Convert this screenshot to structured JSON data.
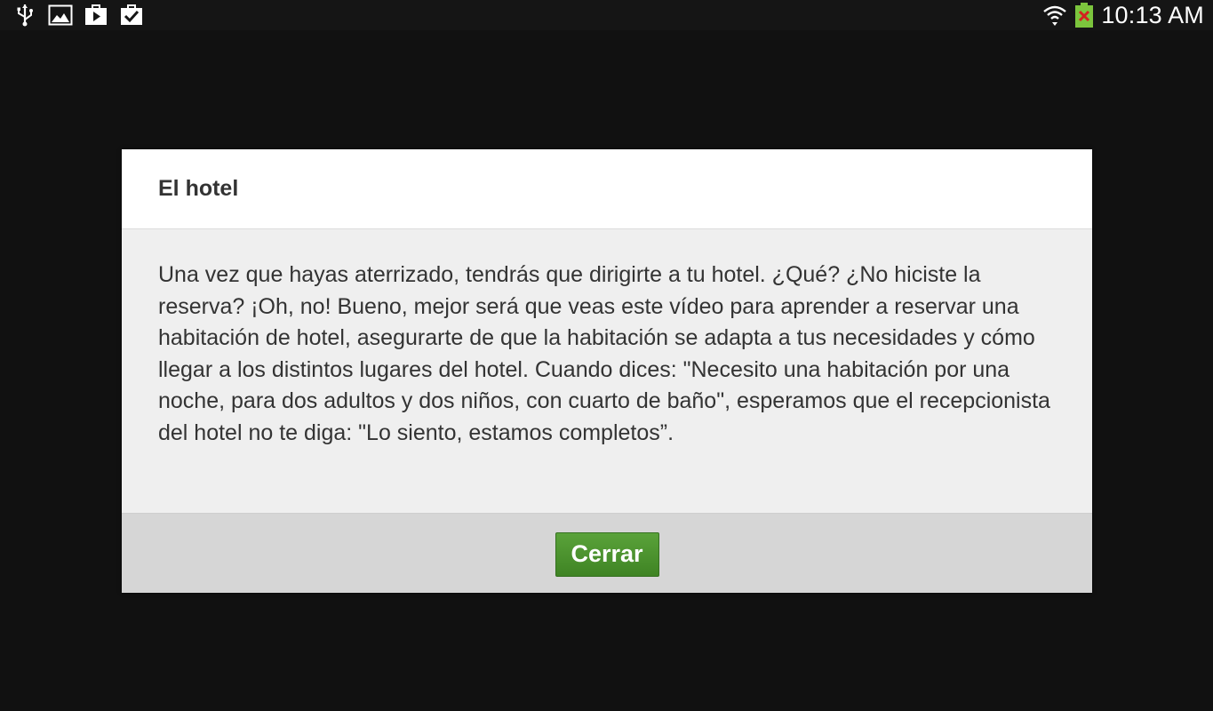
{
  "status_bar": {
    "left_icons": [
      "usb-icon",
      "image-notification-icon",
      "play-store-icon",
      "task-check-icon"
    ],
    "right_icons": [
      "wifi-icon",
      "battery-icon"
    ],
    "time": "10:13 AM"
  },
  "dialog": {
    "title": "El hotel",
    "body": "Una vez que hayas aterrizado, tendrás que dirigirte a tu hotel. ¿Qué? ¿No hiciste la reserva? ¡Oh, no! Bueno, mejor será que veas este vídeo para aprender a reservar una habitación de hotel, asegurarte de que la habitación se adapta a tus necesidades y cómo llegar a los distintos lugares del hotel. Cuando dices: \"Necesito una habitación por una noche, para dos adultos y dos niños, con cuarto de baño\", esperamos que el recepcionista del hotel no te diga: \"Lo siento, estamos completos”.",
    "close_label": "Cerrar"
  },
  "colors": {
    "background": "#111111",
    "button": "#4a9130",
    "battery": "#7cc53d"
  }
}
